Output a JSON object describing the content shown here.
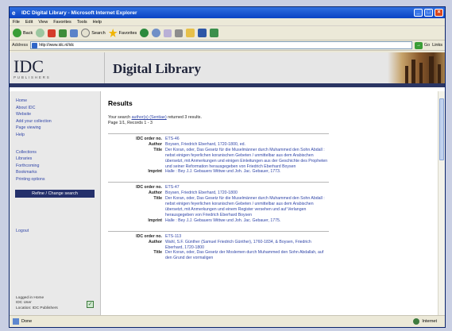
{
  "window": {
    "title": "IDC Digital Library - Microsoft Internet Explorer"
  },
  "menubar": {
    "items": [
      "File",
      "Edit",
      "View",
      "Favorites",
      "Tools",
      "Help"
    ]
  },
  "toolbar": {
    "back": "Back",
    "search": "Search",
    "favorites": "Favorites"
  },
  "address": {
    "label": "Address",
    "value": "http://www.idc.nl/idc",
    "go": "Go",
    "links": "Links"
  },
  "banner": {
    "logo_mark": "IDC",
    "logo_sub": "PUBLISHERS",
    "site_title": "Digital Library"
  },
  "sidebar": {
    "group1": [
      "Home",
      "About IDC",
      "Website",
      "Add your collection",
      "Page viewing",
      "Help"
    ],
    "group2": [
      "Collections",
      "Libraries",
      "Forthcoming",
      "Bookmarks",
      "Printing options"
    ],
    "refine_label": "Refine / Change search",
    "logout_label": "Logout",
    "footer": [
      "Logged in Home",
      "IDC User",
      "Location: IDC Publishers"
    ]
  },
  "content": {
    "heading": "Results",
    "summary_prefix": "Your search",
    "summary_link": "author(s) (Sentiae)",
    "summary_suffix": "returned 3 results.",
    "pages": "Page 1/1, Records 1 - 3"
  },
  "records": [
    {
      "idc_label": "IDC order no.",
      "idc": "ETS-46",
      "author_label": "Author",
      "author": "Boysen, Friedrich Eberhard, 1720-1800, ed.",
      "title_label": "Title",
      "title": "Der Koran, oder, Das Gesetz für die Muselmänner durch Muhammed den Sohn Abdall : nebst einigen feyerlichen koranischen Gebeten / unmittelbar aus dem Arabischen übersetzt, mit Anmerkungen und einigen Einleitungen aus der Geschichte des Propheten und seiner Reformation herausgegeben von Friedrich Eberhard Boysen",
      "imprint_label": "Imprint",
      "imprint": "Halle : Bey J.J. Gebauers Wittwe und Joh. Jac. Gebauer, 1773."
    },
    {
      "idc_label": "IDC order no.",
      "idc": "ETS-47",
      "author_label": "Author",
      "author": "Boysen, Friedrich Eberhard, 1720-1800",
      "title_label": "Title",
      "title": "Der Koran, oder, Das Gesetz für die Muselmänner durch Muhammed den Sohn Abdall : nebst einigen feyerlichen koranischen Gebeten / unmittelbar aus dem Arabischen übersetzt, mit Anmerkungen und einem Register versehen und auf Verlangen herausgegeben von Friedrich Eberhard Boysen",
      "imprint_label": "Imprint",
      "imprint": "Halle : Bey J.J. Gebauers Wittwe und Joh. Jac. Gebauer, 1775."
    },
    {
      "idc_label": "IDC order no.",
      "idc": "ETS-113",
      "author_label": "Author",
      "author": "Wahl, S.F. Günther (Samuel Friedrich Günther), 1760-1834, & Boysen, Friedrich Eberhard, 1720-1800",
      "title_label": "Title",
      "title": "Der Koran, oder, Das Gesetz der Moslemen durch Muhammed den Sohn Abdallah, auf den Grund der vormaligen"
    }
  ],
  "statusbar": {
    "text": "Done",
    "zone": "Internet"
  }
}
